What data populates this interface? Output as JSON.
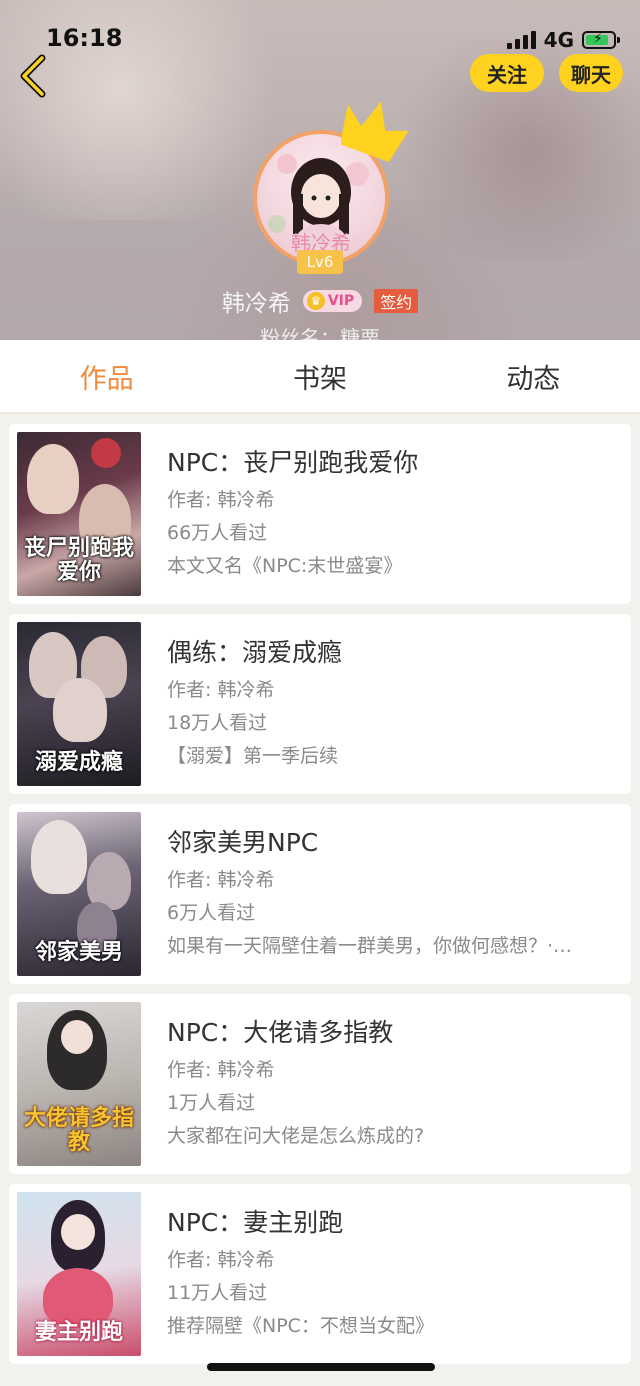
{
  "status_bar": {
    "time": "16:18",
    "network": "4G",
    "signal_icon": "signal-bars-icon",
    "battery_icon": "battery-charging-icon"
  },
  "header": {
    "back_icon": "chevron-left-icon",
    "follow_label": "关注",
    "chat_label": "聊天",
    "level": "Lv6",
    "user_name": "韩冷希",
    "vip_label": "VIP",
    "sign_label": "签约",
    "fan_name": "粉丝名：糖栗",
    "accent_color": "#ffd21f"
  },
  "tabs": [
    {
      "label": "作品",
      "active": true
    },
    {
      "label": "书架",
      "active": false
    },
    {
      "label": "动态",
      "active": false
    }
  ],
  "books": [
    {
      "title": "NPC：丧尸别跑我爱你",
      "author": "作者: 韩冷希",
      "views": "66万人看过",
      "desc": "本文又名《NPC:末世盛宴》",
      "cover_text": "丧尸别跑我爱你"
    },
    {
      "title": "偶练：溺爱成瘾",
      "author": "作者: 韩冷希",
      "views": "18万人看过",
      "desc": "【溺爱】第一季后续",
      "cover_text": "溺爱成瘾"
    },
    {
      "title": "邻家美男NPC",
      "author": "作者: 韩冷希",
      "views": "6万人看过",
      "desc": "如果有一天隔壁住着一群美男，你做何感想？·…",
      "cover_text": "邻家美男"
    },
    {
      "title": "NPC：大佬请多指教",
      "author": "作者: 韩冷希",
      "views": "1万人看过",
      "desc": "大家都在问大佬是怎么炼成的?",
      "cover_text": "大佬请多指教"
    },
    {
      "title": "NPC：妻主别跑",
      "author": "作者: 韩冷希",
      "views": "11万人看过",
      "desc": "推荐隔壁《NPC：不想当女配》",
      "cover_text": "妻主别跑"
    }
  ]
}
